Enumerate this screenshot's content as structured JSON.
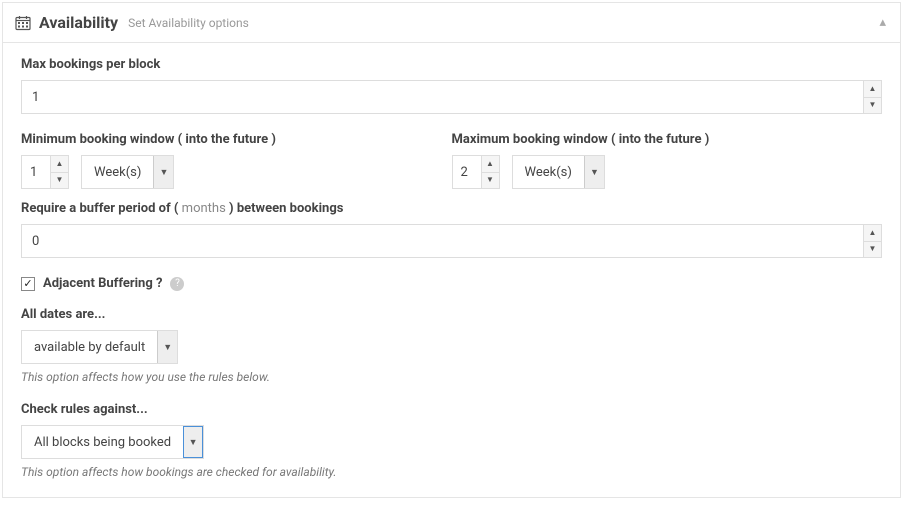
{
  "header": {
    "title": "Availability",
    "subtitle": "Set Availability options"
  },
  "max_bookings": {
    "label": "Max bookings per block",
    "value": "1"
  },
  "min_window": {
    "label": "Minimum booking window ( into the future )",
    "value": "1",
    "unit": "Week(s)"
  },
  "max_window": {
    "label": "Maximum booking window ( into the future )",
    "value": "2",
    "unit": "Week(s)"
  },
  "buffer": {
    "label_pre": "Require a buffer period of ( ",
    "label_unit": "months",
    "label_post": " ) between bookings",
    "value": "0"
  },
  "adjacent": {
    "label": "Adjacent Buffering ?",
    "checked": true
  },
  "all_dates": {
    "label": "All dates are...",
    "value": "available by default",
    "hint": "This option affects how you use the rules below."
  },
  "check_rules": {
    "label": "Check rules against...",
    "value": "All blocks being booked",
    "hint": "This option affects how bookings are checked for availability."
  }
}
